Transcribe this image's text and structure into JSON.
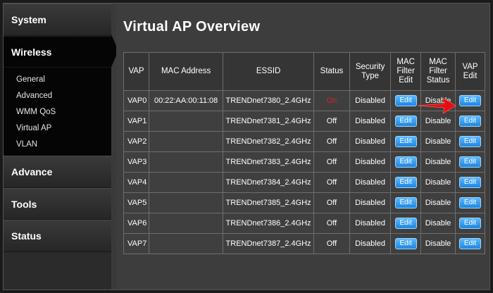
{
  "sidebar": {
    "sections": [
      {
        "id": "system",
        "label": "System"
      },
      {
        "id": "wireless",
        "label": "Wireless"
      },
      {
        "id": "advance",
        "label": "Advance"
      },
      {
        "id": "tools",
        "label": "Tools"
      },
      {
        "id": "status",
        "label": "Status"
      }
    ],
    "wireless_items": [
      {
        "label": "General"
      },
      {
        "label": "Advanced"
      },
      {
        "label": "WMM QoS"
      },
      {
        "label": "Virtual AP"
      },
      {
        "label": "VLAN"
      }
    ]
  },
  "main": {
    "title": "Virtual AP Overview",
    "table": {
      "headers": {
        "vap": "VAP",
        "mac": "MAC Address",
        "essid": "ESSID",
        "status": "Status",
        "security": [
          "Security",
          "Type"
        ],
        "mac_filter_edit": [
          "MAC",
          "Filter",
          "Edit"
        ],
        "mac_filter_status": [
          "MAC",
          "Filter",
          "Status"
        ],
        "vap_edit": [
          "VAP",
          "Edit"
        ]
      },
      "edit_label": "Edit",
      "rows": [
        {
          "vap": "VAP0",
          "mac": "00:22:AA:00:11:08",
          "essid": "TRENDnet7380_2.4GHz",
          "status": "On",
          "security": "Disabled",
          "filter_status": "Disable"
        },
        {
          "vap": "VAP1",
          "mac": "",
          "essid": "TRENDnet7381_2.4GHz",
          "status": "Off",
          "security": "Disabled",
          "filter_status": "Disable"
        },
        {
          "vap": "VAP2",
          "mac": "",
          "essid": "TRENDnet7382_2.4GHz",
          "status": "Off",
          "security": "Disabled",
          "filter_status": "Disable"
        },
        {
          "vap": "VAP3",
          "mac": "",
          "essid": "TRENDnet7383_2.4GHz",
          "status": "Off",
          "security": "Disabled",
          "filter_status": "Disable"
        },
        {
          "vap": "VAP4",
          "mac": "",
          "essid": "TRENDnet7384_2.4GHz",
          "status": "Off",
          "security": "Disabled",
          "filter_status": "Disable"
        },
        {
          "vap": "VAP5",
          "mac": "",
          "essid": "TRENDnet7385_2.4GHz",
          "status": "Off",
          "security": "Disabled",
          "filter_status": "Disable"
        },
        {
          "vap": "VAP6",
          "mac": "",
          "essid": "TRENDnet7386_2.4GHz",
          "status": "Off",
          "security": "Disabled",
          "filter_status": "Disable"
        },
        {
          "vap": "VAP7",
          "mac": "",
          "essid": "TRENDnet7387_2.4GHz",
          "status": "Off",
          "security": "Disabled",
          "filter_status": "Disable"
        }
      ]
    }
  },
  "colors": {
    "status_on": "#e02020",
    "edit_button": "#2a90e8",
    "arrow": "#e01010"
  },
  "icons": {
    "annotation": "red-arrow-icon"
  }
}
